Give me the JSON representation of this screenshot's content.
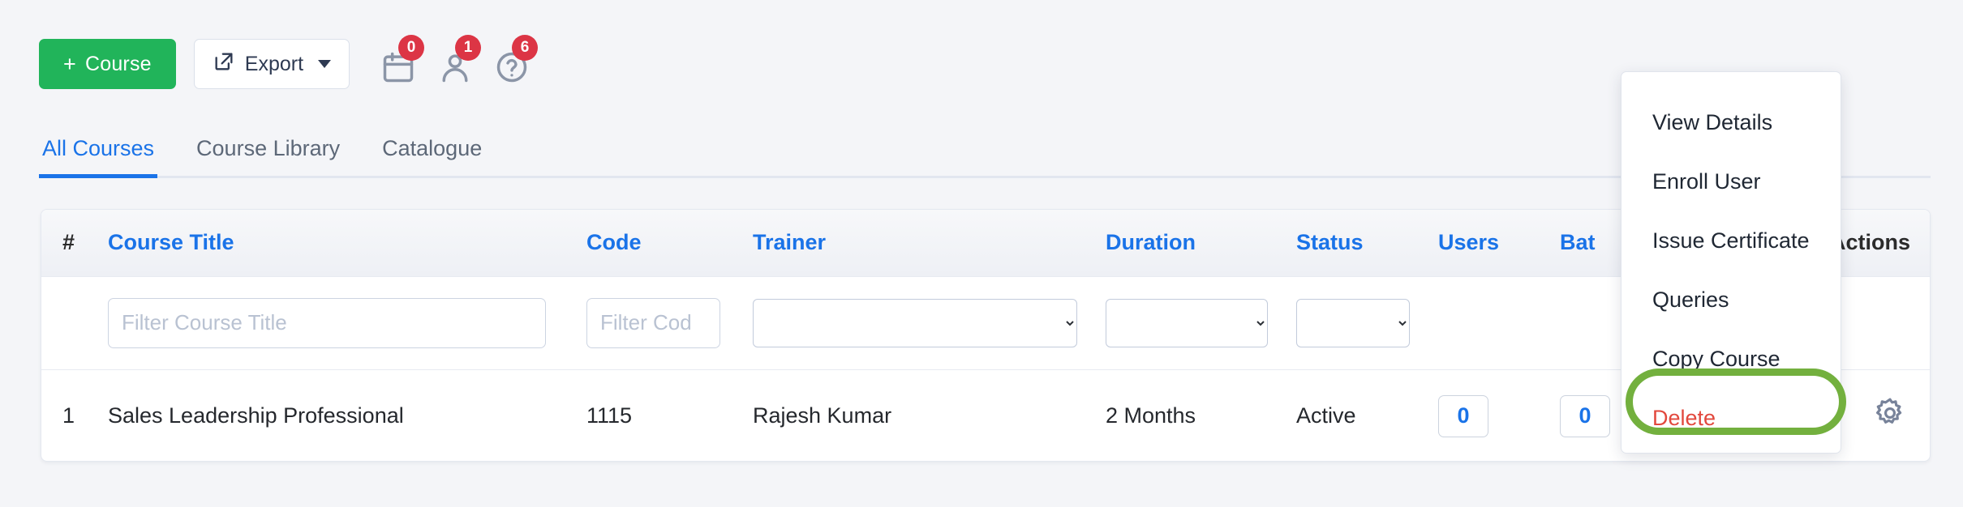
{
  "toolbar": {
    "add_course_label": "Course",
    "add_course_plus": "+",
    "export_label": "Export",
    "icons": [
      {
        "name": "calendar-icon",
        "badge": "0"
      },
      {
        "name": "user-icon",
        "badge": "1"
      },
      {
        "name": "help-circle-icon",
        "badge": "6"
      }
    ]
  },
  "tabs": [
    {
      "label": "All Courses",
      "active": true
    },
    {
      "label": "Course Library",
      "active": false
    },
    {
      "label": "Catalogue",
      "active": false
    }
  ],
  "table": {
    "headers": {
      "num": "#",
      "title": "Course Title",
      "code": "Code",
      "trainer": "Trainer",
      "duration": "Duration",
      "status": "Status",
      "users": "Users",
      "batches": "Bat",
      "actions": "Actions"
    },
    "filters": {
      "title_placeholder": "Filter Course Title",
      "title_value": "",
      "code_placeholder": "Filter Cod",
      "code_value": "",
      "trainer_selected": "",
      "duration_selected": "",
      "status_selected": ""
    },
    "rows": [
      {
        "num": "1",
        "title": "Sales Leadership Professional",
        "code": "1115",
        "trainer": "Rajesh Kumar",
        "duration": "2 Months",
        "status": "Active",
        "users": "0",
        "batches": "0"
      }
    ]
  },
  "action_menu": {
    "items": [
      {
        "label": "View Details",
        "danger": false
      },
      {
        "label": "Enroll User",
        "danger": false
      },
      {
        "label": "Issue Certificate",
        "danger": false
      },
      {
        "label": "Queries",
        "danger": false
      },
      {
        "label": "Copy Course",
        "danger": false
      },
      {
        "label": "Delete",
        "danger": true
      }
    ]
  },
  "colors": {
    "primary_green": "#21b45a",
    "link_blue": "#1a73e8",
    "danger_red": "#e2483d",
    "badge_red": "#dc3545",
    "annotation_green": "#73b03e",
    "page_bg": "#f4f5f8"
  }
}
